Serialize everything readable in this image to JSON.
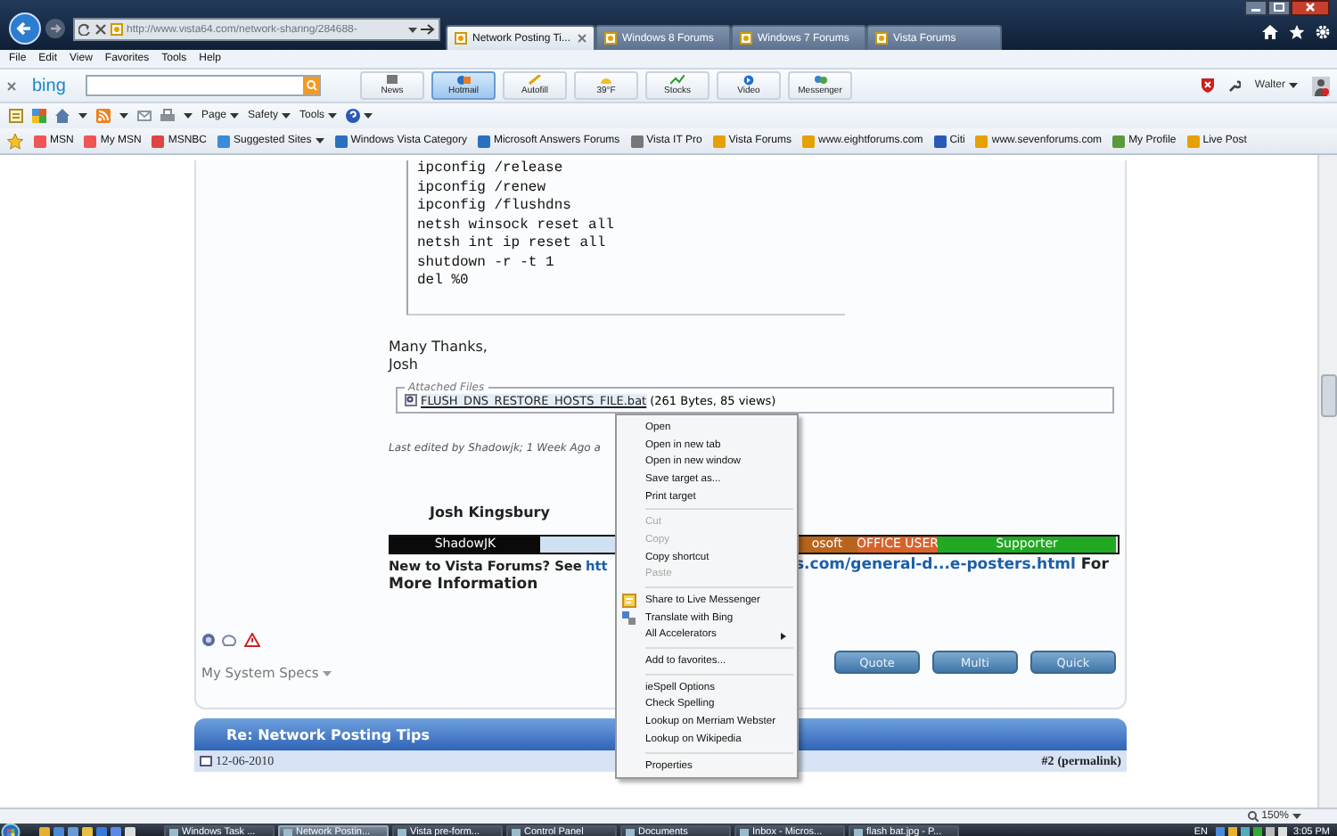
{
  "browser": {
    "address": "http://www.vista64.com/network-sharing/284688-",
    "tabs": [
      {
        "label": "Network Posting Ti...",
        "selected": true
      },
      {
        "label": "Windows 8 Forums",
        "selected": false
      },
      {
        "label": "Windows 7 Forums",
        "selected": false
      },
      {
        "label": "Vista Forums",
        "selected": false
      }
    ],
    "menu": [
      "File",
      "Edit",
      "View",
      "Favorites",
      "Tools",
      "Help"
    ],
    "bing_toolbar": {
      "logo": "bing",
      "buttons": [
        {
          "label": "News",
          "selected": false
        },
        {
          "label": "Hotmail",
          "selected": true
        },
        {
          "label": "Autofill",
          "selected": false
        },
        {
          "label": "39°F",
          "selected": false
        },
        {
          "label": "Stocks",
          "selected": false
        },
        {
          "label": "Video",
          "selected": false
        },
        {
          "label": "Messenger",
          "selected": false
        }
      ],
      "user": "Walter"
    },
    "command_bar": [
      "Page",
      "Safety",
      "Tools"
    ],
    "favorites": [
      {
        "label": "MSN",
        "dropdown": false
      },
      {
        "label": "My MSN",
        "dropdown": false
      },
      {
        "label": "MSNBC",
        "dropdown": false
      },
      {
        "label": "Suggested Sites",
        "dropdown": true
      },
      {
        "label": "Windows Vista Category",
        "dropdown": false
      },
      {
        "label": "Microsoft Answers Forums",
        "dropdown": false
      },
      {
        "label": "Vista IT Pro",
        "dropdown": false
      },
      {
        "label": "Vista Forums",
        "dropdown": false
      },
      {
        "label": "www.eightforums.com",
        "dropdown": false
      },
      {
        "label": "Citi",
        "dropdown": false
      },
      {
        "label": "www.sevenforums.com",
        "dropdown": false
      },
      {
        "label": "My Profile",
        "dropdown": false
      },
      {
        "label": "Live Post",
        "dropdown": false
      }
    ]
  },
  "post": {
    "code": [
      "ipconfig /release",
      "ipconfig /renew",
      "ipconfig /flushdns",
      "netsh winsock reset all",
      "netsh int ip reset all",
      "shutdown -r -t 1",
      "del %0"
    ],
    "closing": [
      "Many Thanks,",
      "Josh"
    ],
    "attachments_legend": "Attached Files",
    "attachment": "FLUSH_DNS_RESTORE_HOSTS_FILE.bat",
    "attachment_info": "(261 Bytes, 85 views)",
    "edit_note": "Last edited by Shadowjk; 1 Week Ago a",
    "signature_name": "Josh Kingsbury",
    "banner": [
      {
        "text": "ShadowJK",
        "color": "#0a0a0a"
      },
      {
        "color": "#cfe1f2"
      },
      {
        "text": "osoft",
        "color": "#b8641c"
      },
      {
        "text": "OFFICE USER",
        "color": "#d9622a"
      },
      {
        "text": "Supporter",
        "color": "#22a822"
      }
    ],
    "promo": {
      "intro": "New to Vista Forums? See",
      "link_start": "htt",
      "link_end": "s.com/general-d...e-posters.html",
      "after_link": "For",
      "more": "More Information"
    },
    "system_specs": "My System Specs",
    "buttons": [
      "Quote",
      "Multi",
      "Quick"
    ]
  },
  "next_post": {
    "title": "Re: Network Posting Tips",
    "date": "12-06-2010",
    "number": "#2",
    "permalink": "(permalink)"
  },
  "context_menu": [
    {
      "kind": "item",
      "label": "Open",
      "disabled": false,
      "submenu": false
    },
    {
      "kind": "item",
      "label": "Open in new tab",
      "disabled": false,
      "submenu": false
    },
    {
      "kind": "item",
      "label": "Open in new window",
      "disabled": false,
      "submenu": false
    },
    {
      "kind": "item",
      "label": "Save target as...",
      "disabled": false,
      "submenu": false
    },
    {
      "kind": "item",
      "label": "Print target",
      "disabled": false,
      "submenu": false
    },
    {
      "kind": "separator"
    },
    {
      "kind": "item",
      "label": "Cut",
      "disabled": true,
      "submenu": false
    },
    {
      "kind": "item",
      "label": "Copy",
      "disabled": true,
      "submenu": false
    },
    {
      "kind": "item",
      "label": "Copy shortcut",
      "disabled": false,
      "submenu": false
    },
    {
      "kind": "item",
      "label": "Paste",
      "disabled": true,
      "submenu": false
    },
    {
      "kind": "separator"
    },
    {
      "kind": "accelerator",
      "label": "Share to Live Messenger",
      "disabled": false,
      "submenu": false
    },
    {
      "kind": "accelerator",
      "label": "Translate with Bing",
      "disabled": false,
      "submenu": false
    },
    {
      "kind": "item",
      "label": "All Accelerators",
      "disabled": false,
      "submenu": true
    },
    {
      "kind": "separator"
    },
    {
      "kind": "item",
      "label": "Add to favorites...",
      "disabled": false,
      "submenu": false
    },
    {
      "kind": "separator"
    },
    {
      "kind": "item",
      "label": "ieSpell Options",
      "disabled": false,
      "submenu": false
    },
    {
      "kind": "item",
      "label": "Check Spelling",
      "disabled": false,
      "submenu": false
    },
    {
      "kind": "item",
      "label": "Lookup on Merriam Webster",
      "disabled": false,
      "submenu": false
    },
    {
      "kind": "item",
      "label": "Lookup on Wikipedia",
      "disabled": false,
      "submenu": false
    },
    {
      "kind": "separator"
    },
    {
      "kind": "item",
      "label": "Properties",
      "disabled": false,
      "submenu": false
    }
  ],
  "status_bar": {
    "zoom": "150%"
  },
  "taskbar": {
    "tasks": [
      {
        "label": "Windows Task ...",
        "selected": false
      },
      {
        "label": "Network Postin...",
        "selected": true
      },
      {
        "label": "Vista pre-form...",
        "selected": false
      },
      {
        "label": "Control Panel",
        "selected": false
      },
      {
        "label": "Documents",
        "selected": false
      },
      {
        "label": "Inbox - Micros...",
        "selected": false
      },
      {
        "label": "flash bat.jpg - P...",
        "selected": false
      }
    ],
    "language": "EN",
    "clock": "3:05 PM"
  }
}
